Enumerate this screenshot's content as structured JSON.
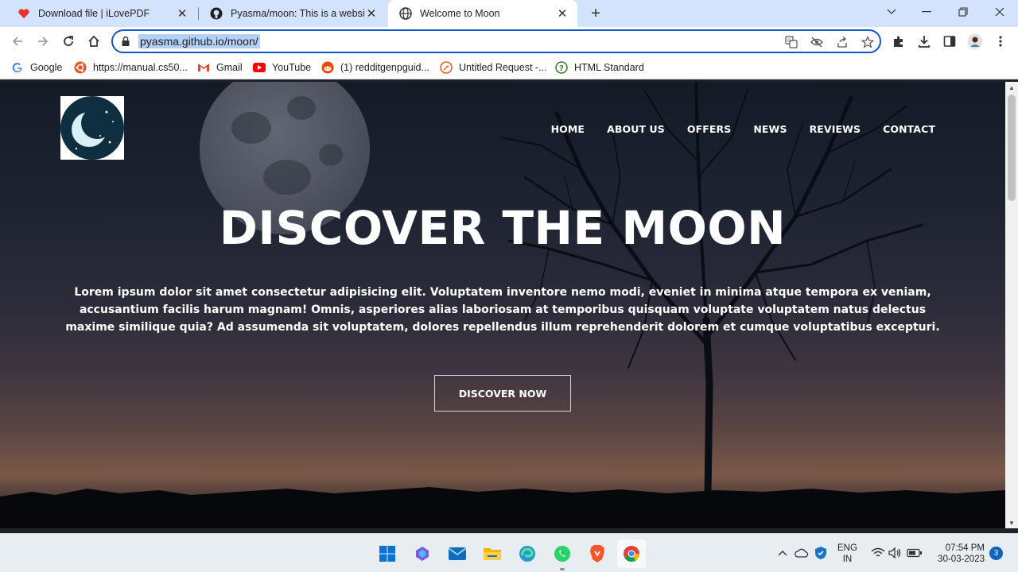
{
  "browser": {
    "tabs": [
      {
        "title": "Download file | iLovePDF",
        "favicon": "heart-icon",
        "active": false
      },
      {
        "title": "Pyasma/moon: This is a website j",
        "favicon": "github-icon",
        "active": false
      },
      {
        "title": "Welcome to Moon",
        "favicon": "globe-icon",
        "active": true
      }
    ],
    "url": "pyasma.github.io/moon/",
    "bookmarks": [
      {
        "label": "Google",
        "icon": "google-icon"
      },
      {
        "label": "https://manual.cs50...",
        "icon": "ubuntu-icon"
      },
      {
        "label": "Gmail",
        "icon": "gmail-icon"
      },
      {
        "label": "YouTube",
        "icon": "youtube-icon"
      },
      {
        "label": "(1) redditgenpguid...",
        "icon": "reddit-icon"
      },
      {
        "label": "Untitled Request -...",
        "icon": "postman-icon"
      },
      {
        "label": "HTML Standard",
        "icon": "help-icon"
      }
    ]
  },
  "page": {
    "nav": [
      "HOME",
      "ABOUT US",
      "OFFERS",
      "NEWS",
      "REVIEWS",
      "CONTACT"
    ],
    "hero_title": "DISCOVER THE MOON",
    "hero_text": "Lorem ipsum dolor sit amet consectetur adipisicing elit. Voluptatem inventore nemo modi, eveniet in minima atque tempora ex veniam, accusantium facilis harum magnam! Omnis, asperiores alias laboriosam at temporibus quisquam voluptate voluptatem natus delectus maxime similique quia? Ad assumenda sit voluptatem, dolores repellendus illum reprehenderit dolorem et cumque voluptatibus excepturi.",
    "hero_button": "DISCOVER NOW"
  },
  "taskbar": {
    "apps": [
      "windows-start-icon",
      "copilot-icon",
      "mail-icon",
      "file-explorer-icon",
      "edge-icon",
      "whatsapp-icon",
      "brave-icon",
      "chrome-icon"
    ],
    "lang_line1": "ENG",
    "lang_line2": "IN",
    "time": "07:54 PM",
    "date": "30-03-2023",
    "notifications": "3"
  },
  "colors": {
    "tabstrip": "#d3e3fd",
    "omnibox_border": "#0b57d0",
    "taskbar": "#e8edf2"
  }
}
